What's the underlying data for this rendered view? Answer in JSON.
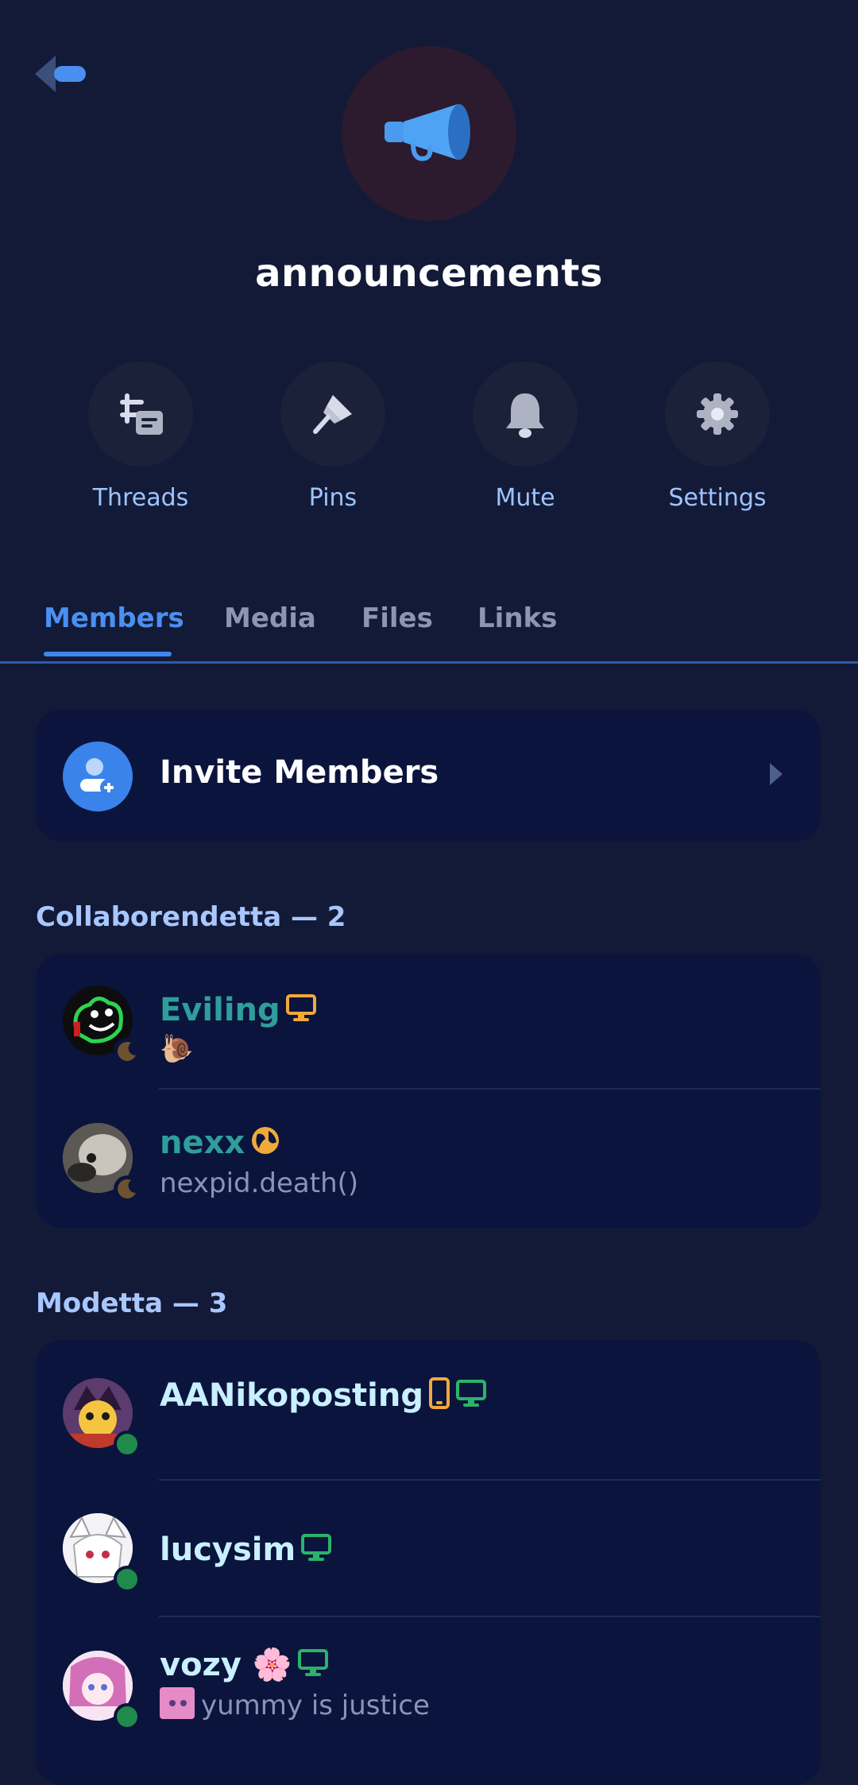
{
  "header": {
    "channel_name": "announcements",
    "back_icon": "back-arrow-icon",
    "channel_icon": "megaphone-icon"
  },
  "actions": [
    {
      "label": "Threads",
      "icon": "threads-icon"
    },
    {
      "label": "Pins",
      "icon": "pin-icon"
    },
    {
      "label": "Mute",
      "icon": "bell-icon"
    },
    {
      "label": "Settings",
      "icon": "gear-icon"
    }
  ],
  "tabs": [
    {
      "label": "Members",
      "active": true
    },
    {
      "label": "Media",
      "active": false
    },
    {
      "label": "Files",
      "active": false
    },
    {
      "label": "Links",
      "active": false
    }
  ],
  "invite": {
    "label": "Invite Members"
  },
  "sections": [
    {
      "title": "Collaborendetta — 2",
      "members": [
        {
          "name": "Eviling",
          "status": "idle",
          "subtitle": "🐌",
          "name_color": "#2f9e9a",
          "device": "desktop"
        },
        {
          "name": "nexx",
          "status": "idle",
          "subtitle": "nexpid.death()",
          "name_color": "#2f9e9a",
          "device": "web"
        }
      ]
    },
    {
      "title": "Modetta — 3",
      "members": [
        {
          "name": "AANikoposting",
          "status": "online",
          "subtitle": "",
          "name_color": "#c8f0ff",
          "device": "mobile+desktop"
        },
        {
          "name": "lucysim",
          "status": "online",
          "subtitle": "",
          "name_color": "#c8f0ff",
          "device": "desktop"
        },
        {
          "name": "vozy 🌸",
          "status": "online",
          "subtitle": "yummy is justice",
          "name_color": "#c8f0ff",
          "device": "desktop"
        }
      ]
    }
  ],
  "colors": {
    "background": "#121a37",
    "card": "#0b143d",
    "accent": "#3d86f0",
    "online": "#1f8a4c",
    "idle": "#6e5230",
    "device_orange": "#f0a93a",
    "device_green": "#2bb36a"
  }
}
